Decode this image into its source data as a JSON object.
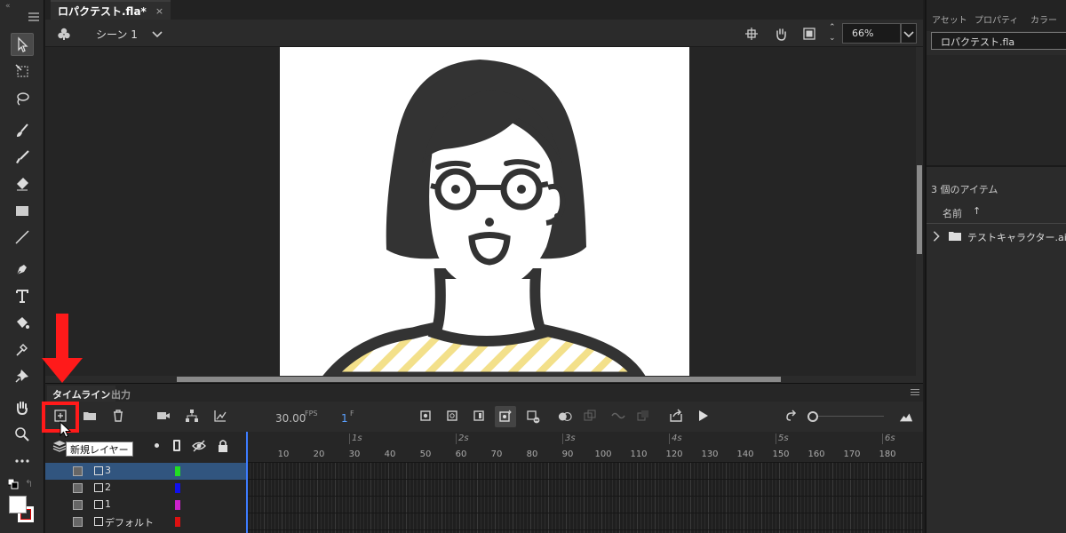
{
  "document": {
    "tab_title": "ロパクテスト.fla*",
    "close_glyph": "×"
  },
  "scene": {
    "name": "シーン 1",
    "zoom": "66%"
  },
  "timeline": {
    "tabs": [
      "タイムライン",
      "出力"
    ],
    "fps": "30.00",
    "fps_unit": "FPS",
    "frame": "1",
    "frame_unit": "F",
    "tooltip": "新規レイヤー",
    "seconds": [
      "1s",
      "2s",
      "3s",
      "4s",
      "5s",
      "6s"
    ],
    "frame_numbers": [
      "10",
      "20",
      "30",
      "40",
      "50",
      "60",
      "70",
      "80",
      "90",
      "100",
      "110",
      "120",
      "130",
      "140",
      "150",
      "160",
      "170",
      "180"
    ],
    "layers": [
      {
        "name": "3",
        "color": "#22dd22",
        "selected": true
      },
      {
        "name": "2",
        "color": "#1010ee",
        "selected": false
      },
      {
        "name": "1",
        "color": "#cc22cc",
        "selected": false
      },
      {
        "name": "デフォルト",
        "color": "#dd1111",
        "selected": false
      }
    ]
  },
  "panel": {
    "tabs": [
      "アセット",
      "プロパティ",
      "カラー"
    ],
    "doc_field": "ロパクテスト.fla",
    "item_count": "3 個のアイテム",
    "sort_label": "名前",
    "sort_arrow": "↑",
    "folder": "テストキャラクター.ai"
  },
  "colors": {
    "accent_red": "#ff1a1a",
    "selected_layer": "#31557f",
    "stripe_yellow": "#f3e08a",
    "figure": "#333333"
  }
}
